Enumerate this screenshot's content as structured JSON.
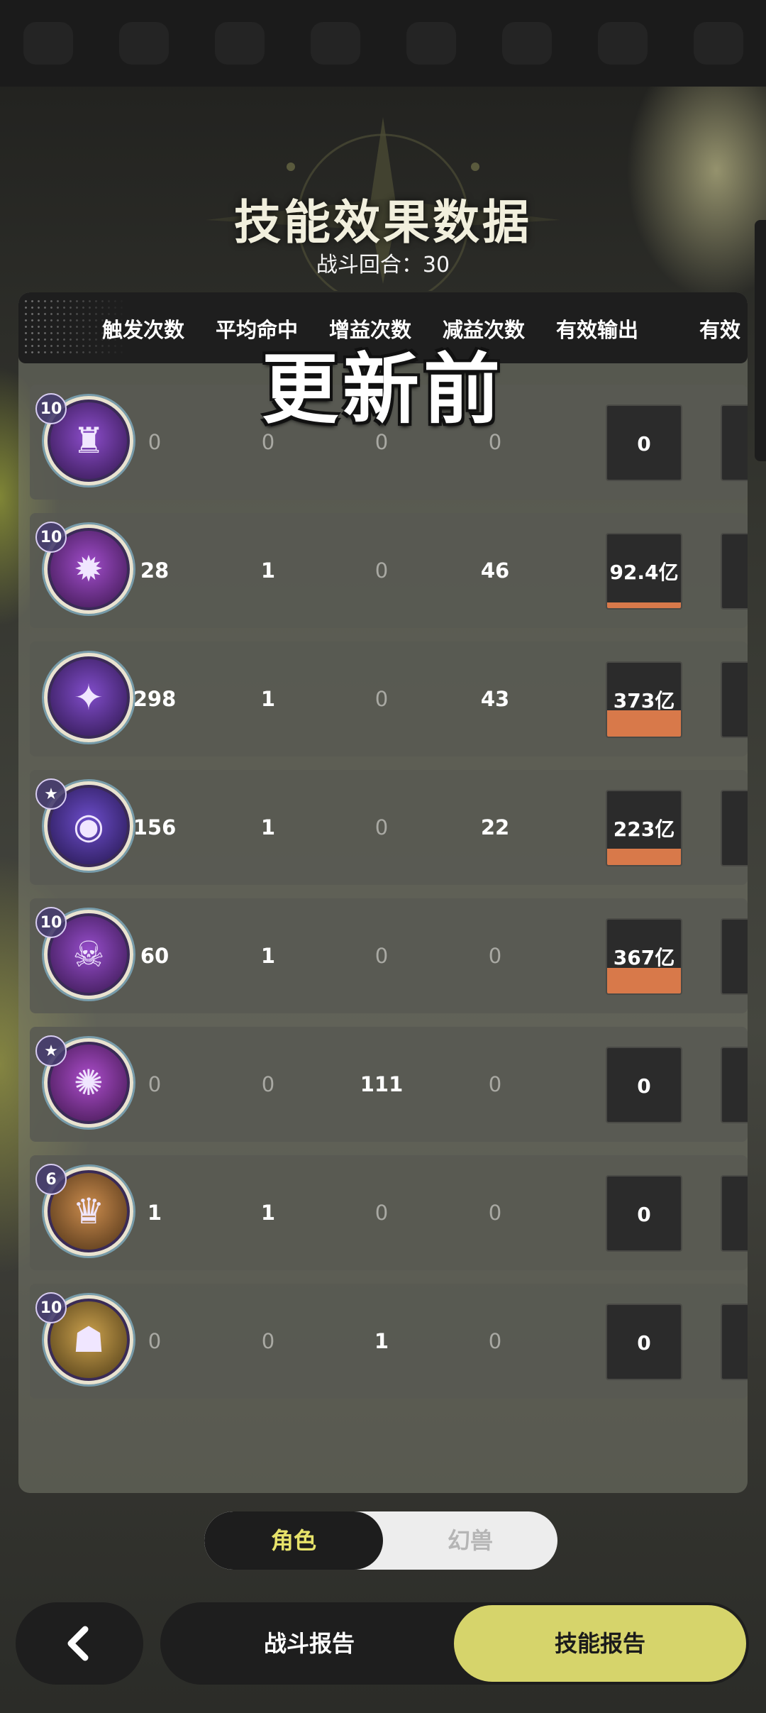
{
  "title": "技能效果数据",
  "round_label": "战斗回合：30",
  "overlay_text": "更新前",
  "columns": [
    "触发次数",
    "平均命中",
    "增益次数",
    "减益次数",
    "有效输出",
    "有效"
  ],
  "rows": [
    {
      "level": "10",
      "icon": "golem-skill-icon",
      "glyph": "♜",
      "trigger": "0",
      "avg_hit": "0",
      "buff": "0",
      "debuff": "0",
      "output": "0",
      "output_fill": 0
    },
    {
      "level": "10",
      "icon": "flame-altar-icon",
      "glyph": "✹",
      "trigger": "28",
      "avg_hit": "1",
      "buff": "0",
      "debuff": "46",
      "output": "92.4亿",
      "output_fill": 0.08
    },
    {
      "level": "",
      "icon": "star-slash-icon",
      "glyph": "✦",
      "trigger": "298",
      "avg_hit": "1",
      "buff": "0",
      "debuff": "43",
      "output": "373亿",
      "output_fill": 0.36
    },
    {
      "level": "★",
      "icon": "void-orb-icon",
      "glyph": "◉",
      "trigger": "156",
      "avg_hit": "1",
      "buff": "0",
      "debuff": "22",
      "output": "223亿",
      "output_fill": 0.22
    },
    {
      "level": "10",
      "icon": "skull-burst-icon",
      "glyph": "☠",
      "trigger": "60",
      "avg_hit": "1",
      "buff": "0",
      "debuff": "0",
      "output": "367亿",
      "output_fill": 0.35
    },
    {
      "level": "★",
      "icon": "dark-nova-icon",
      "glyph": "✺",
      "trigger": "0",
      "avg_hit": "0",
      "buff": "111",
      "debuff": "0",
      "output": "0",
      "output_fill": 0
    },
    {
      "level": "6",
      "icon": "golden-totem-icon",
      "glyph": "♛",
      "trigger": "1",
      "avg_hit": "1",
      "buff": "0",
      "debuff": "0",
      "output": "0",
      "output_fill": 0
    },
    {
      "level": "10",
      "icon": "shadow-idol-icon",
      "glyph": "☗",
      "trigger": "0",
      "avg_hit": "0",
      "buff": "1",
      "debuff": "0",
      "output": "0",
      "output_fill": 0
    }
  ],
  "toggle": {
    "active": "角色",
    "inactive": "幻兽"
  },
  "nav": {
    "back_icon": "back-chevron-icon",
    "tab_battle": "战斗报告",
    "tab_skill": "技能报告"
  },
  "colors": {
    "accent": "#d6d46b",
    "toggle_active_text": "#e7e36a",
    "output_bar": "#d8794a"
  }
}
